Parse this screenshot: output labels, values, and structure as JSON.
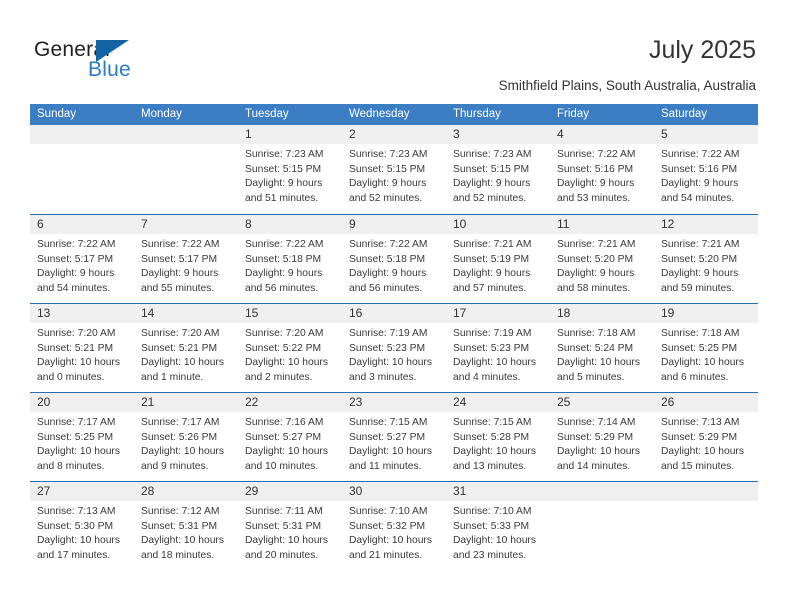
{
  "brand": {
    "name_part1": "General",
    "name_part2": "Blue",
    "mark": "triangle-flag-icon",
    "color_primary": "#1464a5",
    "color_text": "#2b7cc4"
  },
  "header": {
    "title": "July 2025",
    "subtitle": "Smithfield Plains, South Australia, Australia"
  },
  "theme": {
    "header_blue": "#3c7ec4",
    "row_divider_blue": "#2b6cb0",
    "day_band_gray": "#efefef"
  },
  "weekdays": [
    "Sunday",
    "Monday",
    "Tuesday",
    "Wednesday",
    "Thursday",
    "Friday",
    "Saturday"
  ],
  "weeks": [
    [
      {
        "day": "",
        "lines": []
      },
      {
        "day": "",
        "lines": []
      },
      {
        "day": "1",
        "lines": [
          "Sunrise: 7:23 AM",
          "Sunset: 5:15 PM",
          "Daylight: 9 hours",
          "and 51 minutes."
        ]
      },
      {
        "day": "2",
        "lines": [
          "Sunrise: 7:23 AM",
          "Sunset: 5:15 PM",
          "Daylight: 9 hours",
          "and 52 minutes."
        ]
      },
      {
        "day": "3",
        "lines": [
          "Sunrise: 7:23 AM",
          "Sunset: 5:15 PM",
          "Daylight: 9 hours",
          "and 52 minutes."
        ]
      },
      {
        "day": "4",
        "lines": [
          "Sunrise: 7:22 AM",
          "Sunset: 5:16 PM",
          "Daylight: 9 hours",
          "and 53 minutes."
        ]
      },
      {
        "day": "5",
        "lines": [
          "Sunrise: 7:22 AM",
          "Sunset: 5:16 PM",
          "Daylight: 9 hours",
          "and 54 minutes."
        ]
      }
    ],
    [
      {
        "day": "6",
        "lines": [
          "Sunrise: 7:22 AM",
          "Sunset: 5:17 PM",
          "Daylight: 9 hours",
          "and 54 minutes."
        ]
      },
      {
        "day": "7",
        "lines": [
          "Sunrise: 7:22 AM",
          "Sunset: 5:17 PM",
          "Daylight: 9 hours",
          "and 55 minutes."
        ]
      },
      {
        "day": "8",
        "lines": [
          "Sunrise: 7:22 AM",
          "Sunset: 5:18 PM",
          "Daylight: 9 hours",
          "and 56 minutes."
        ]
      },
      {
        "day": "9",
        "lines": [
          "Sunrise: 7:22 AM",
          "Sunset: 5:18 PM",
          "Daylight: 9 hours",
          "and 56 minutes."
        ]
      },
      {
        "day": "10",
        "lines": [
          "Sunrise: 7:21 AM",
          "Sunset: 5:19 PM",
          "Daylight: 9 hours",
          "and 57 minutes."
        ]
      },
      {
        "day": "11",
        "lines": [
          "Sunrise: 7:21 AM",
          "Sunset: 5:20 PM",
          "Daylight: 9 hours",
          "and 58 minutes."
        ]
      },
      {
        "day": "12",
        "lines": [
          "Sunrise: 7:21 AM",
          "Sunset: 5:20 PM",
          "Daylight: 9 hours",
          "and 59 minutes."
        ]
      }
    ],
    [
      {
        "day": "13",
        "lines": [
          "Sunrise: 7:20 AM",
          "Sunset: 5:21 PM",
          "Daylight: 10 hours",
          "and 0 minutes."
        ]
      },
      {
        "day": "14",
        "lines": [
          "Sunrise: 7:20 AM",
          "Sunset: 5:21 PM",
          "Daylight: 10 hours",
          "and 1 minute."
        ]
      },
      {
        "day": "15",
        "lines": [
          "Sunrise: 7:20 AM",
          "Sunset: 5:22 PM",
          "Daylight: 10 hours",
          "and 2 minutes."
        ]
      },
      {
        "day": "16",
        "lines": [
          "Sunrise: 7:19 AM",
          "Sunset: 5:23 PM",
          "Daylight: 10 hours",
          "and 3 minutes."
        ]
      },
      {
        "day": "17",
        "lines": [
          "Sunrise: 7:19 AM",
          "Sunset: 5:23 PM",
          "Daylight: 10 hours",
          "and 4 minutes."
        ]
      },
      {
        "day": "18",
        "lines": [
          "Sunrise: 7:18 AM",
          "Sunset: 5:24 PM",
          "Daylight: 10 hours",
          "and 5 minutes."
        ]
      },
      {
        "day": "19",
        "lines": [
          "Sunrise: 7:18 AM",
          "Sunset: 5:25 PM",
          "Daylight: 10 hours",
          "and 6 minutes."
        ]
      }
    ],
    [
      {
        "day": "20",
        "lines": [
          "Sunrise: 7:17 AM",
          "Sunset: 5:25 PM",
          "Daylight: 10 hours",
          "and 8 minutes."
        ]
      },
      {
        "day": "21",
        "lines": [
          "Sunrise: 7:17 AM",
          "Sunset: 5:26 PM",
          "Daylight: 10 hours",
          "and 9 minutes."
        ]
      },
      {
        "day": "22",
        "lines": [
          "Sunrise: 7:16 AM",
          "Sunset: 5:27 PM",
          "Daylight: 10 hours",
          "and 10 minutes."
        ]
      },
      {
        "day": "23",
        "lines": [
          "Sunrise: 7:15 AM",
          "Sunset: 5:27 PM",
          "Daylight: 10 hours",
          "and 11 minutes."
        ]
      },
      {
        "day": "24",
        "lines": [
          "Sunrise: 7:15 AM",
          "Sunset: 5:28 PM",
          "Daylight: 10 hours",
          "and 13 minutes."
        ]
      },
      {
        "day": "25",
        "lines": [
          "Sunrise: 7:14 AM",
          "Sunset: 5:29 PM",
          "Daylight: 10 hours",
          "and 14 minutes."
        ]
      },
      {
        "day": "26",
        "lines": [
          "Sunrise: 7:13 AM",
          "Sunset: 5:29 PM",
          "Daylight: 10 hours",
          "and 15 minutes."
        ]
      }
    ],
    [
      {
        "day": "27",
        "lines": [
          "Sunrise: 7:13 AM",
          "Sunset: 5:30 PM",
          "Daylight: 10 hours",
          "and 17 minutes."
        ]
      },
      {
        "day": "28",
        "lines": [
          "Sunrise: 7:12 AM",
          "Sunset: 5:31 PM",
          "Daylight: 10 hours",
          "and 18 minutes."
        ]
      },
      {
        "day": "29",
        "lines": [
          "Sunrise: 7:11 AM",
          "Sunset: 5:31 PM",
          "Daylight: 10 hours",
          "and 20 minutes."
        ]
      },
      {
        "day": "30",
        "lines": [
          "Sunrise: 7:10 AM",
          "Sunset: 5:32 PM",
          "Daylight: 10 hours",
          "and 21 minutes."
        ]
      },
      {
        "day": "31",
        "lines": [
          "Sunrise: 7:10 AM",
          "Sunset: 5:33 PM",
          "Daylight: 10 hours",
          "and 23 minutes."
        ]
      },
      {
        "day": "",
        "lines": []
      },
      {
        "day": "",
        "lines": []
      }
    ]
  ]
}
